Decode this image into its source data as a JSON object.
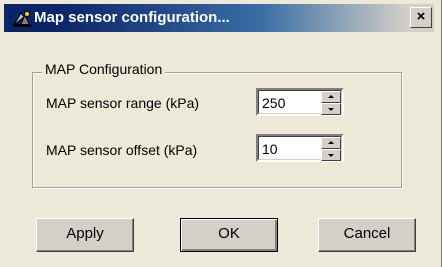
{
  "window": {
    "title": "Map sensor configuration...",
    "close_label": "×"
  },
  "group": {
    "legend": "MAP Configuration"
  },
  "fields": {
    "range": {
      "label": "MAP sensor range (kPa)",
      "value": "250"
    },
    "offset": {
      "label": "MAP sensor offset  (kPa)",
      "value": "10"
    }
  },
  "buttons": {
    "apply": "Apply",
    "ok": "OK",
    "cancel": "Cancel"
  }
}
